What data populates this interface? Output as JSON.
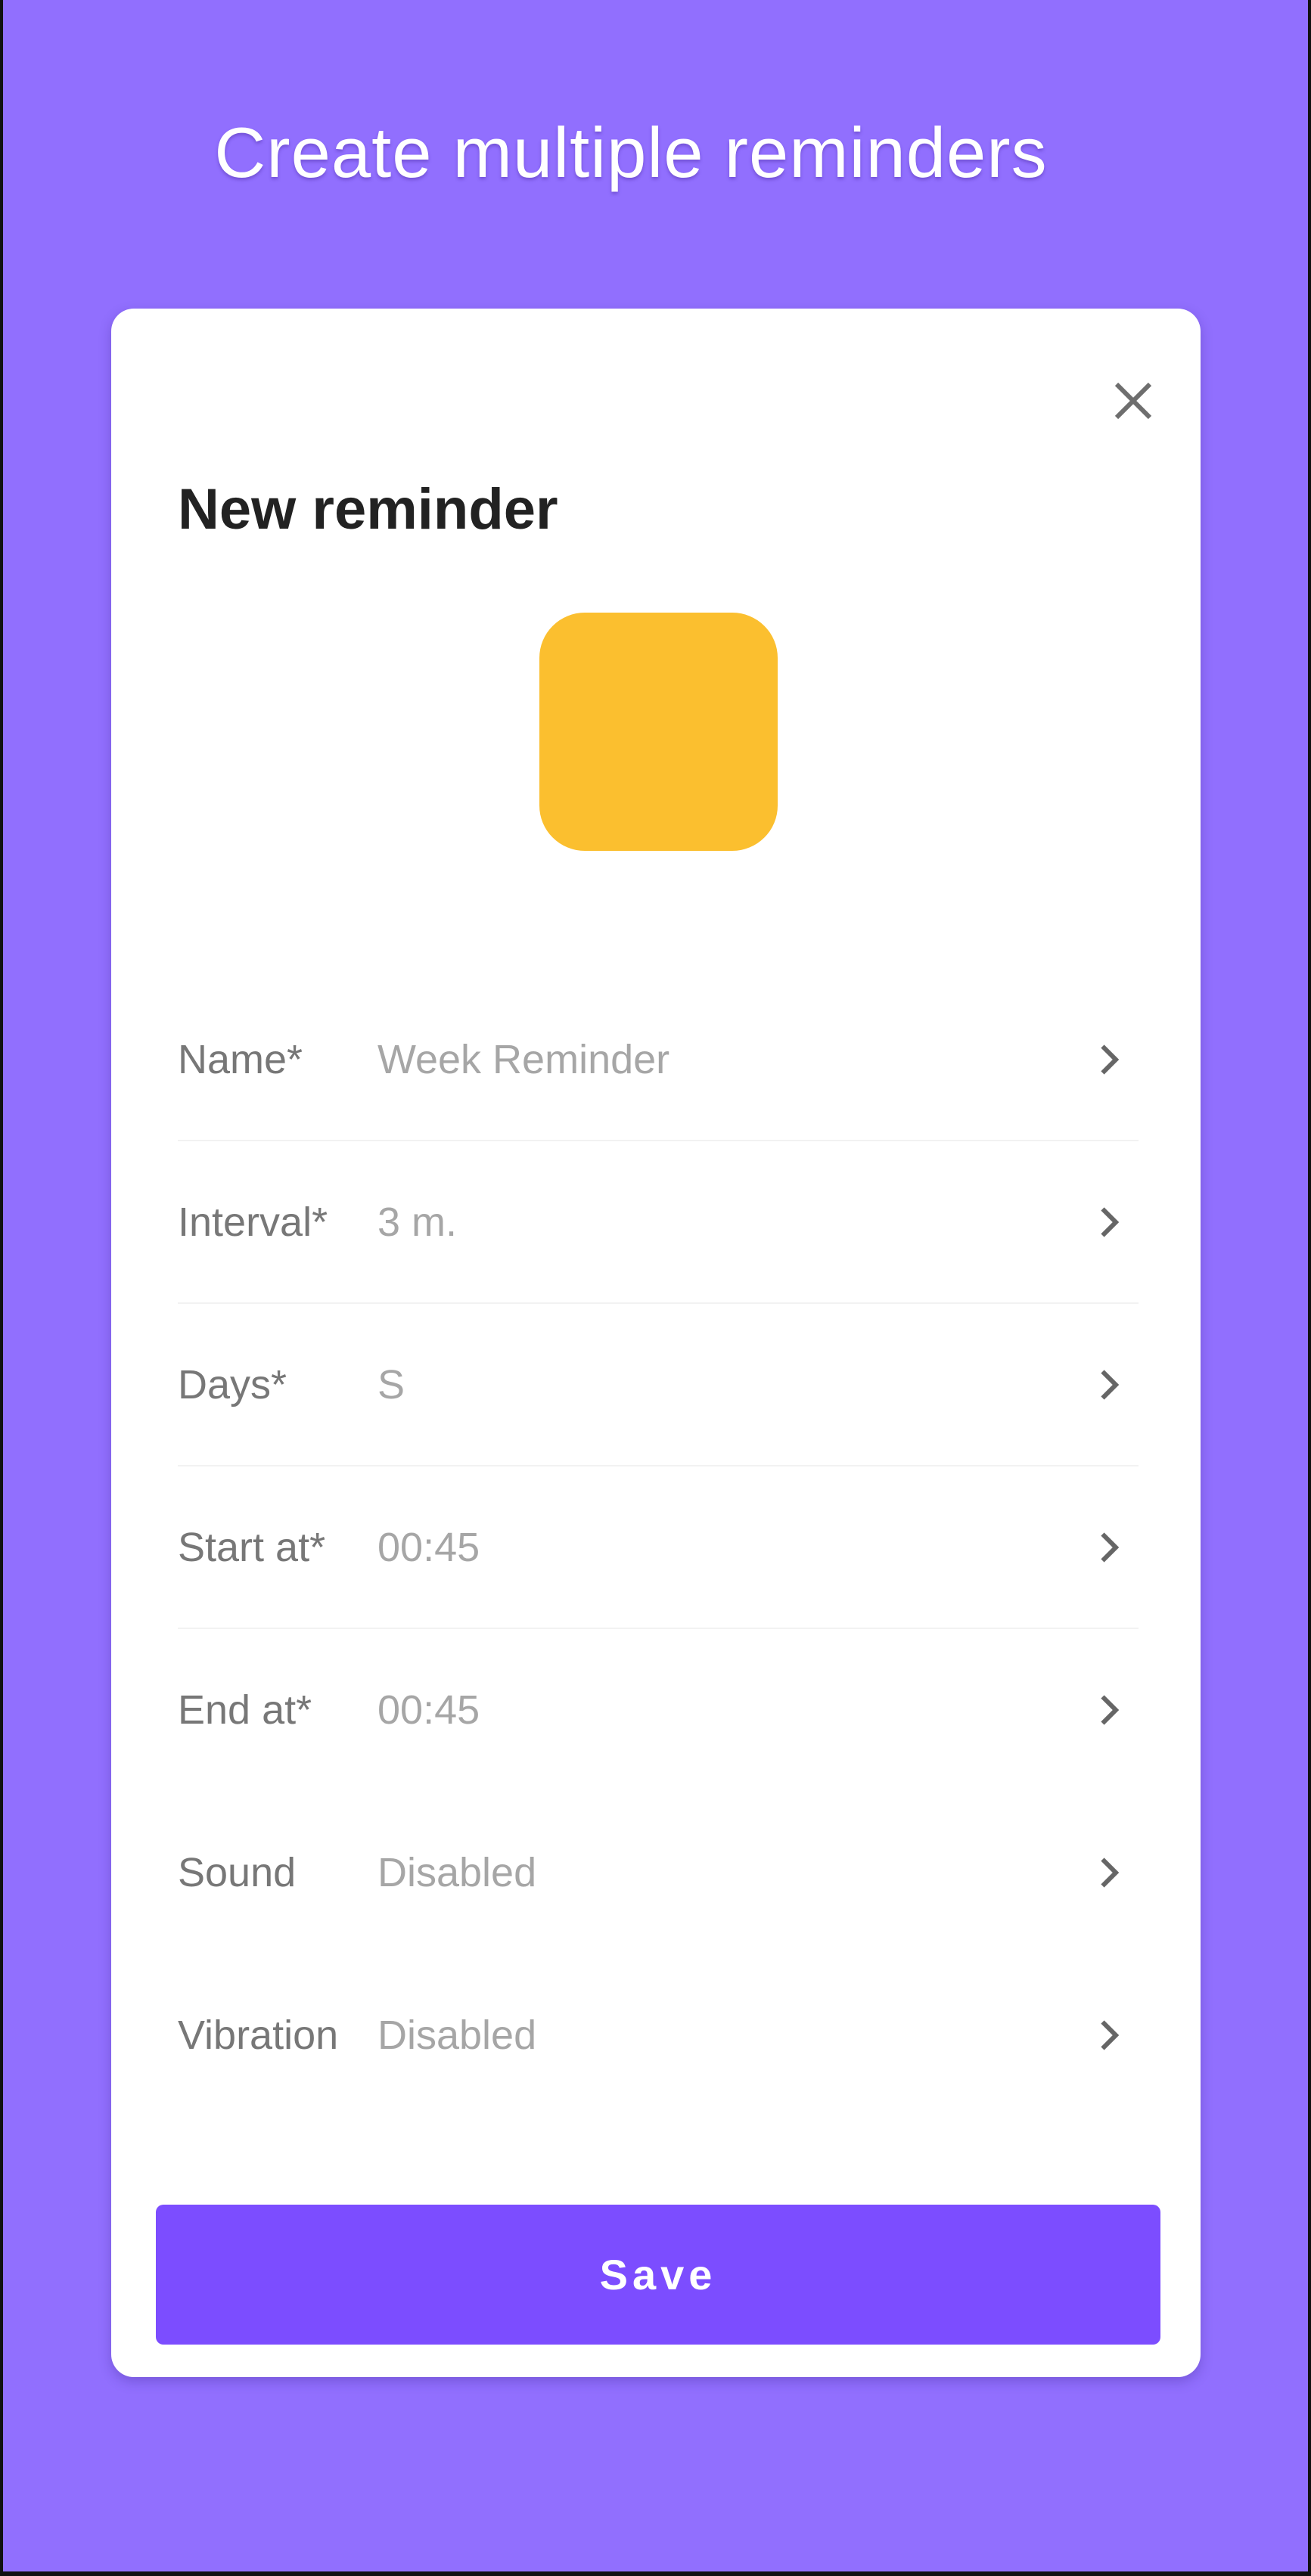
{
  "headline": "Create multiple reminders",
  "dialog": {
    "title": "New reminder",
    "close_icon": "close-icon",
    "swatch_color": "#fbbf2f",
    "fields": [
      {
        "label": "Name*",
        "value": "Week Reminder",
        "icon": "chevron-right-icon"
      },
      {
        "label": "Interval*",
        "value": "3 m.",
        "icon": "chevron-right-icon"
      },
      {
        "label": "Days*",
        "value": "S",
        "icon": "chevron-right-icon"
      },
      {
        "label": "Start at*",
        "value": "00:45",
        "icon": "chevron-right-icon"
      },
      {
        "label": "End at*",
        "value": "00:45",
        "icon": "chevron-right-icon"
      },
      {
        "label": "Sound",
        "value": "Disabled",
        "icon": "chevron-right-icon"
      },
      {
        "label": "Vibration",
        "value": "Disabled",
        "icon": "chevron-right-icon"
      }
    ],
    "save_label": "Save"
  },
  "colors": {
    "background": "#916ffe",
    "accent": "#7c4dff",
    "card": "#ffffff"
  }
}
